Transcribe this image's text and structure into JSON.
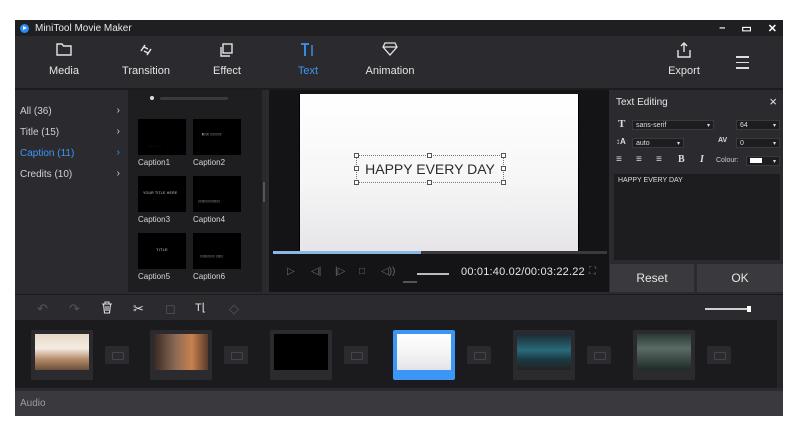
{
  "window": {
    "title": "MiniTool Movie Maker",
    "controls": [
      "–",
      "▭",
      "✕"
    ]
  },
  "toolbar": {
    "items": [
      {
        "label": "Media",
        "icon": "folder-icon"
      },
      {
        "label": "Transition",
        "icon": "transition-icon"
      },
      {
        "label": "Effect",
        "icon": "effect-icon"
      },
      {
        "label": "Text",
        "icon": "text-icon",
        "active": true
      },
      {
        "label": "Animation",
        "icon": "diamond-icon"
      }
    ],
    "export_label": "Export"
  },
  "categories": [
    {
      "label": "All (36)"
    },
    {
      "label": "Title (15)"
    },
    {
      "label": "Caption (11)",
      "active": true
    },
    {
      "label": "Credits (10)"
    }
  ],
  "captions": [
    {
      "label": "Caption1",
      "preview": "· · · · · ·"
    },
    {
      "label": "Caption2",
      "preview": "▮▯▯▯ ▯▯▯▯▯▯"
    },
    {
      "label": "Caption3",
      "preview": "YOUR TITLE HERE"
    },
    {
      "label": "Caption4",
      "preview": "▯▯▯▯▯▯▯▯▯▯▯▯"
    },
    {
      "label": "Caption5",
      "preview": "TITLE"
    },
    {
      "label": "Caption6",
      "preview": "▯▯▯▯▯▯▯▯ ▯▯▯▯"
    }
  ],
  "preview": {
    "caption_text": "HAPPY EVERY DAY",
    "time": "00:01:40.02/00:03:22.22",
    "progress_fraction": 0.44
  },
  "text_editing": {
    "title": "Text Editing",
    "font": "sans-serif",
    "size": "64",
    "line_spacing": "auto",
    "char_spacing": "0",
    "colour_label": "Colour:",
    "text": "HAPPY EVERY DAY",
    "reset_label": "Reset",
    "ok_label": "OK"
  },
  "timeline": {
    "audio_label": "Audio",
    "zoom_fraction": 0.95
  },
  "colors": {
    "accent": "#3d95f5",
    "background": "#2b2b2f",
    "dark": "#1b1b1e"
  }
}
